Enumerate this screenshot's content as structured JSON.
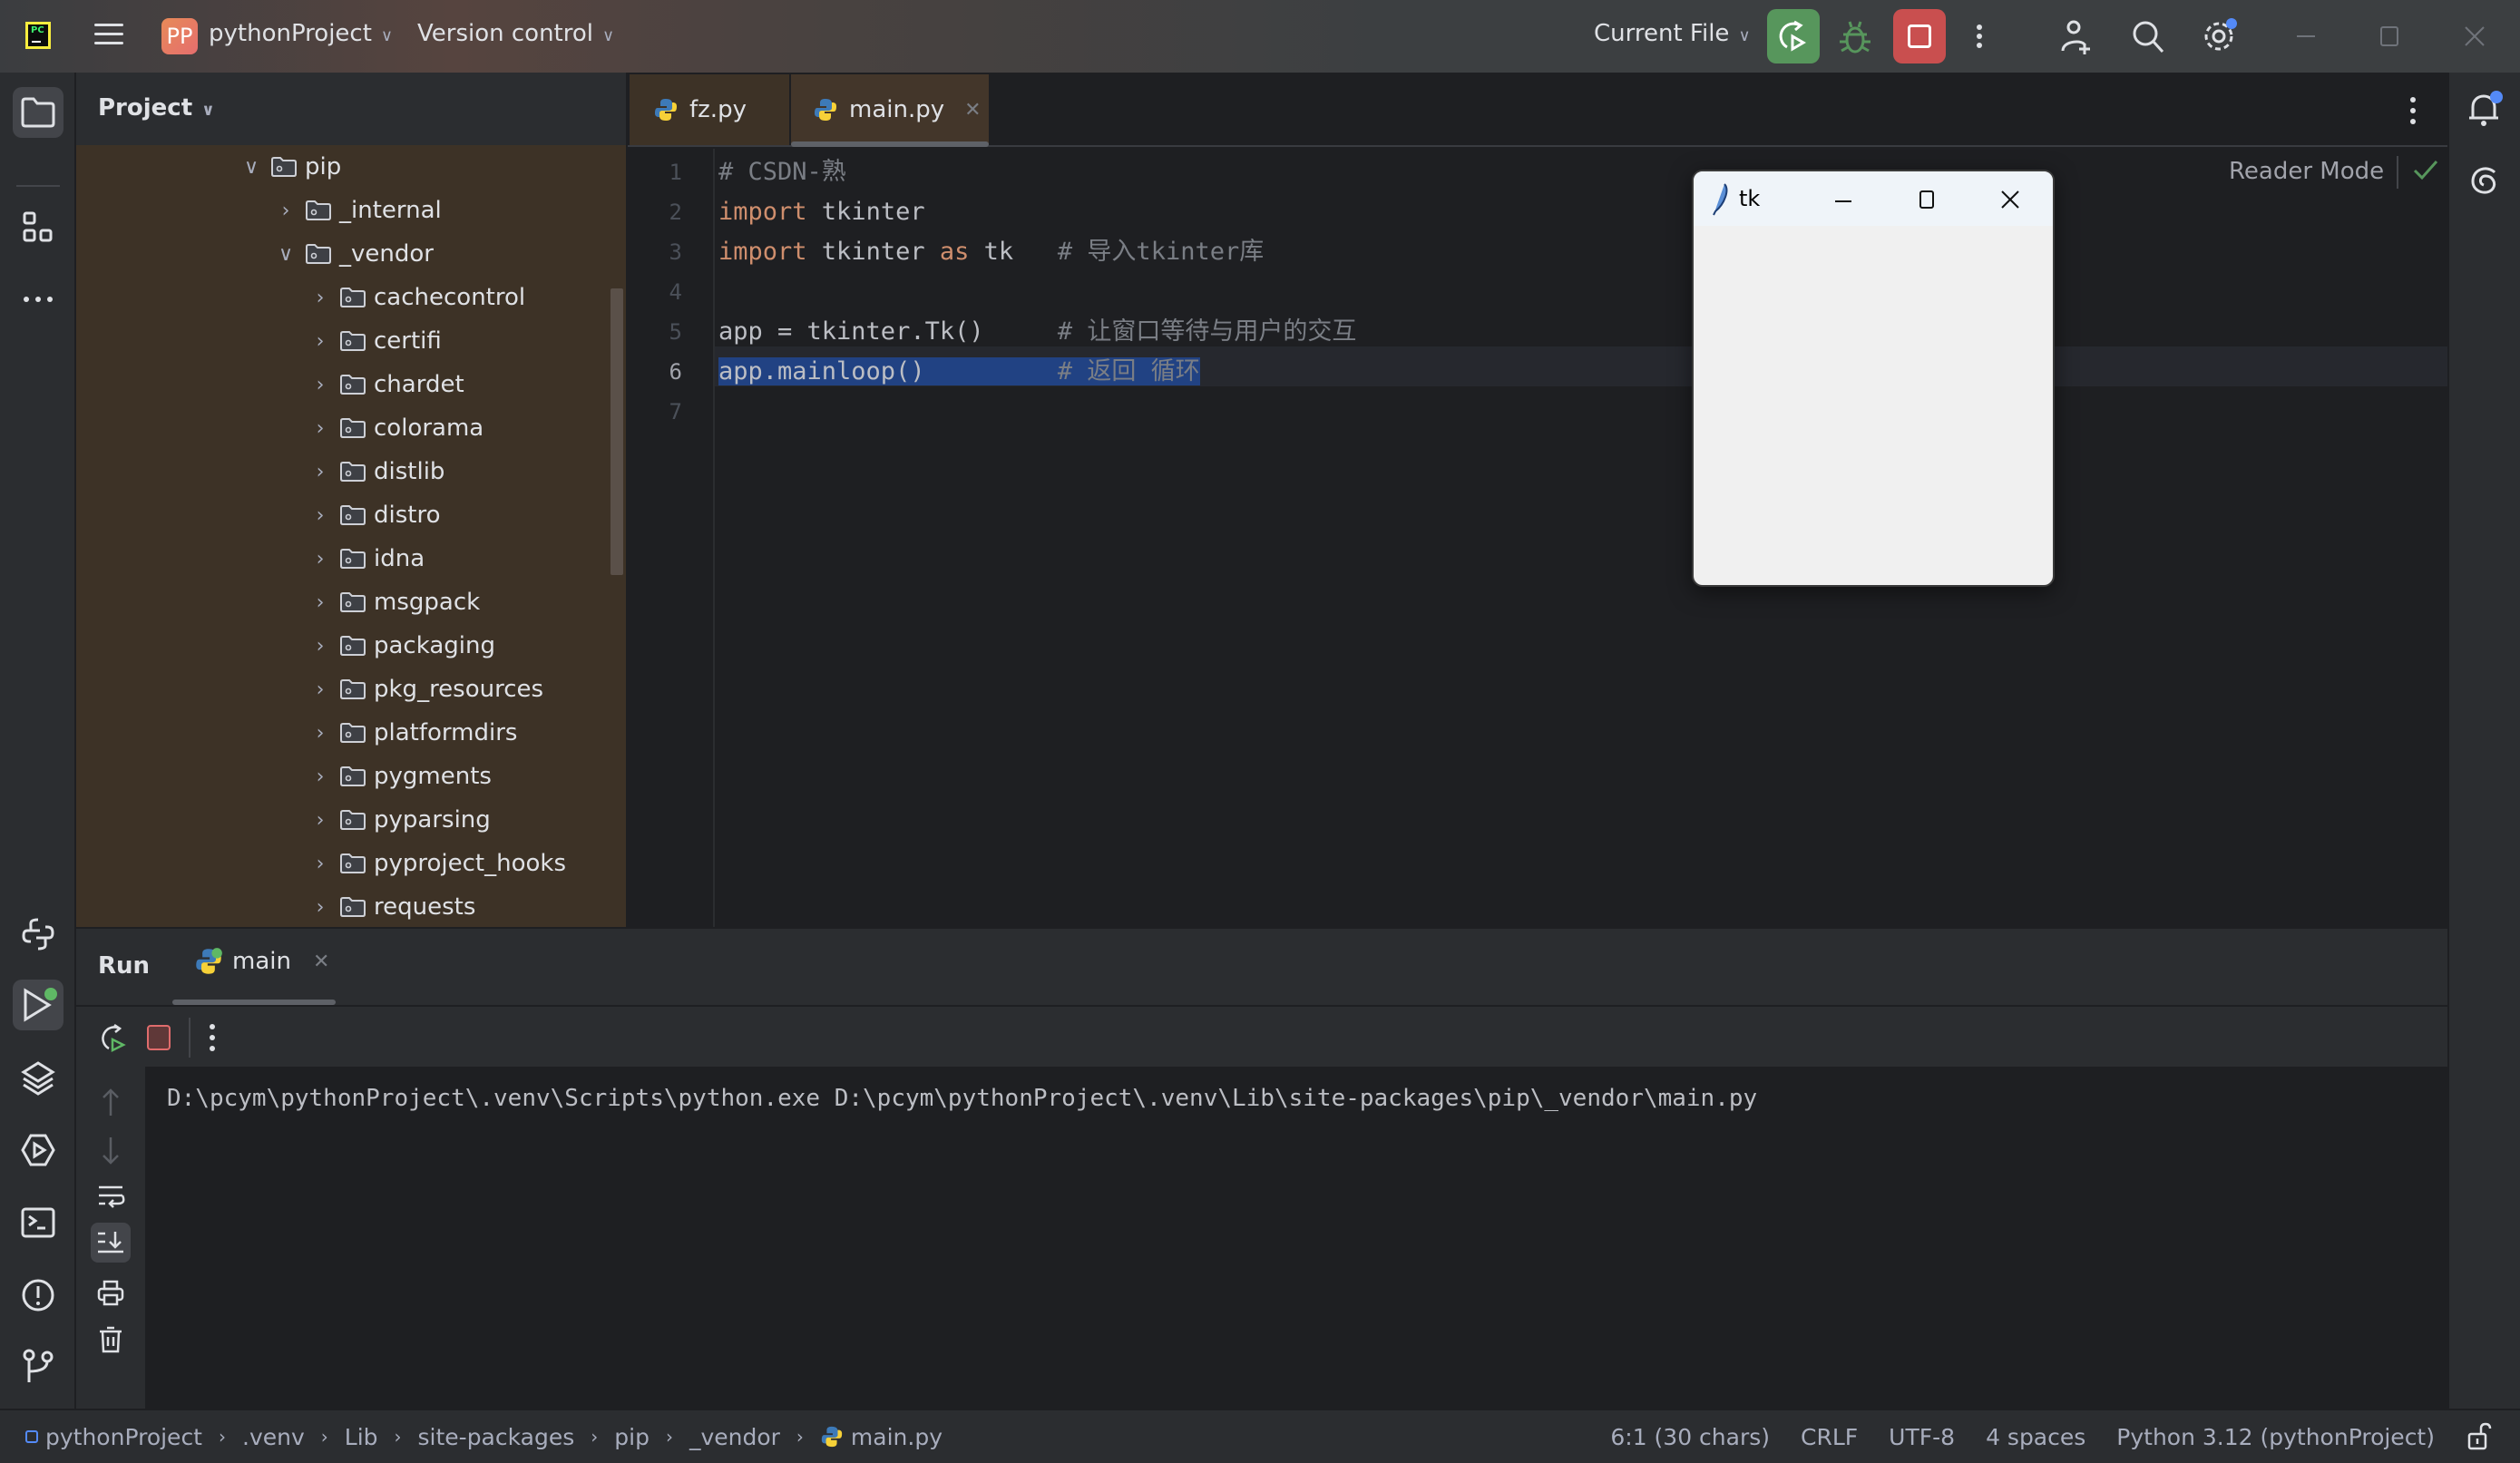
{
  "titlebar": {
    "project_badge": "PP",
    "project_name": "pythonProject",
    "version_control": "Version control",
    "run_config": "Current File",
    "accent_run": "#57965c",
    "accent_stop": "#c94f4f"
  },
  "project_panel": {
    "title": "Project",
    "tree": [
      {
        "label": "pip",
        "expanded": true,
        "depth": 0
      },
      {
        "label": "_internal",
        "expanded": false,
        "depth": 1
      },
      {
        "label": "_vendor",
        "expanded": true,
        "depth": 1
      },
      {
        "label": "cachecontrol",
        "expanded": false,
        "depth": 2
      },
      {
        "label": "certifi",
        "expanded": false,
        "depth": 2
      },
      {
        "label": "chardet",
        "expanded": false,
        "depth": 2
      },
      {
        "label": "colorama",
        "expanded": false,
        "depth": 2
      },
      {
        "label": "distlib",
        "expanded": false,
        "depth": 2
      },
      {
        "label": "distro",
        "expanded": false,
        "depth": 2
      },
      {
        "label": "idna",
        "expanded": false,
        "depth": 2
      },
      {
        "label": "msgpack",
        "expanded": false,
        "depth": 2
      },
      {
        "label": "packaging",
        "expanded": false,
        "depth": 2
      },
      {
        "label": "pkg_resources",
        "expanded": false,
        "depth": 2
      },
      {
        "label": "platformdirs",
        "expanded": false,
        "depth": 2
      },
      {
        "label": "pygments",
        "expanded": false,
        "depth": 2
      },
      {
        "label": "pyparsing",
        "expanded": false,
        "depth": 2
      },
      {
        "label": "pyproject_hooks",
        "expanded": false,
        "depth": 2
      },
      {
        "label": "requests",
        "expanded": false,
        "depth": 2
      }
    ]
  },
  "editor": {
    "tabs": [
      {
        "label": "fz.py",
        "active": false
      },
      {
        "label": "main.py",
        "active": true
      }
    ],
    "reader_mode": "Reader Mode",
    "lines": [
      {
        "num": "1",
        "code": "",
        "comment": "# CSDN-熟"
      },
      {
        "num": "2",
        "kw": "import",
        "code": " tkinter",
        "comment": ""
      },
      {
        "num": "3",
        "kw": "import",
        "code": " tkinter ",
        "kw2": "as",
        "code2": " tk   ",
        "comment": "# 导入tkinter库"
      },
      {
        "num": "4",
        "code": "",
        "comment": ""
      },
      {
        "num": "5",
        "code": "app = tkinter.Tk()     ",
        "comment": "# 让窗口等待与用户的交互"
      },
      {
        "num": "6",
        "code": "app.mainloop()         ",
        "comment": "# 返回 循环"
      },
      {
        "num": "7",
        "code": "",
        "comment": ""
      }
    ]
  },
  "tk_window": {
    "title": "tk"
  },
  "run_panel": {
    "title": "Run",
    "tab_label": "main",
    "console_output": "D:\\pcym\\pythonProject\\.venv\\Scripts\\python.exe D:\\pcym\\pythonProject\\.venv\\Lib\\site-packages\\pip\\_vendor\\main.py"
  },
  "statusbar": {
    "breadcrumbs": [
      "pythonProject",
      ".venv",
      "Lib",
      "site-packages",
      "pip",
      "_vendor",
      "main.py"
    ],
    "position": "6:1 (30 chars)",
    "line_ending": "CRLF",
    "encoding": "UTF-8",
    "indent": "4 spaces",
    "interpreter": "Python 3.12 (pythonProject)"
  }
}
